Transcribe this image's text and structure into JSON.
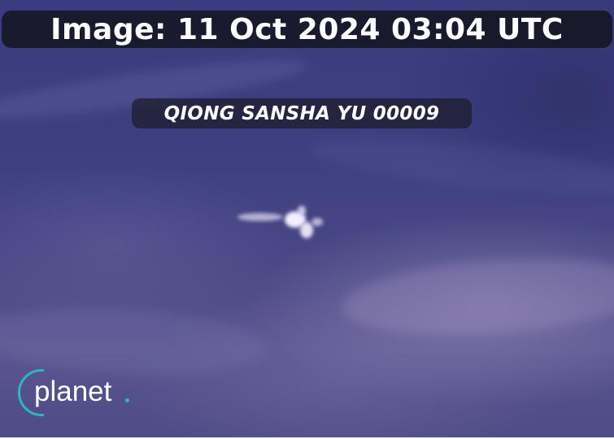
{
  "overlay": {
    "title": "Image: 11 Oct 2024 03:04 UTC",
    "vessel_name": "QIONG SANSHA YU 00009"
  },
  "logo": {
    "wordmark": "planet",
    "accent_color": "#2bb6c4"
  },
  "colors": {
    "background": "#3d3f80",
    "label_background": "#14141e",
    "text": "#ffffff"
  }
}
